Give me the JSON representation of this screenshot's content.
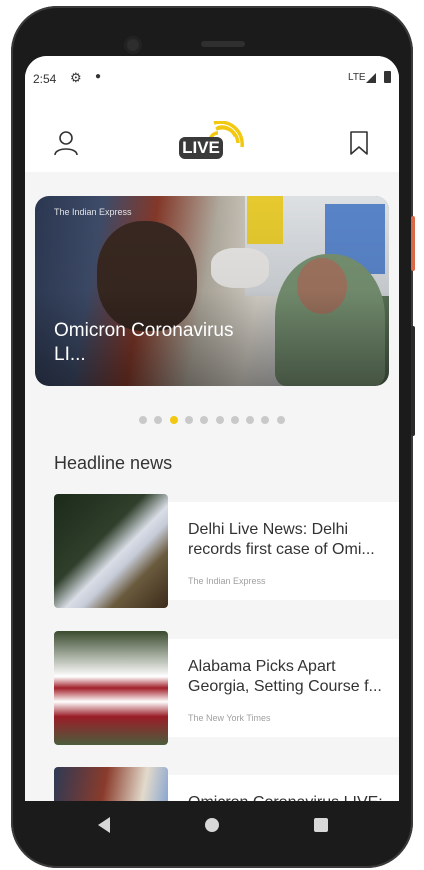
{
  "status_bar": {
    "time": "2:54",
    "network": "LTE"
  },
  "app_bar": {
    "logo_text": "LIVE",
    "accent_color": "#f2c811"
  },
  "carousel": {
    "source": "The Indian Express",
    "title": "Omicron Coronavirus LI...",
    "dot_count": 10,
    "active_index": 2
  },
  "section": {
    "title": "Headline news"
  },
  "news": [
    {
      "headline": "Delhi Live News: Delhi records first case of Omi...",
      "source": "The Indian Express"
    },
    {
      "headline": "Alabama Picks Apart Georgia, Setting Course f...",
      "source": "The New York Times"
    },
    {
      "headline": "Omicron Coronavirus LIVE:",
      "source": ""
    }
  ]
}
